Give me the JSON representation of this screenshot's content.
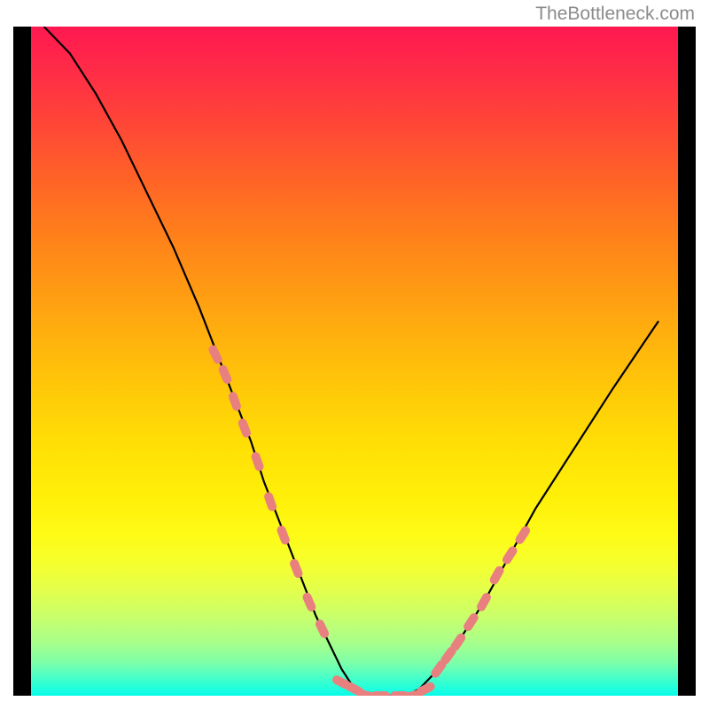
{
  "watermark": "TheBottleneck.com",
  "chart_data": {
    "type": "line",
    "title": "",
    "xlabel": "",
    "ylabel": "",
    "xlim": [
      0,
      100
    ],
    "ylim": [
      0,
      100
    ],
    "grid": false,
    "series": [
      {
        "name": "bottleneck-curve",
        "color": "#000000",
        "x": [
          2,
          6,
          10,
          14,
          18,
          22,
          26,
          28,
          30,
          32,
          34,
          36,
          38,
          40,
          42,
          44,
          46,
          48,
          50,
          52,
          54,
          56,
          58,
          60,
          62,
          66,
          70,
          74,
          78,
          84,
          90,
          97
        ],
        "y": [
          100,
          96,
          90,
          83,
          75,
          67,
          58,
          53,
          48,
          43,
          38,
          32,
          27,
          22,
          17,
          12,
          8,
          4,
          1,
          0,
          0,
          0,
          0,
          1,
          3,
          8,
          14,
          21,
          28,
          37,
          46,
          56
        ]
      }
    ],
    "markers": [
      {
        "name": "left-descent-markers",
        "color": "#e98080",
        "shape": "pill",
        "x": [
          28.5,
          30,
          31.5,
          33,
          35,
          37,
          39,
          41,
          43,
          45
        ],
        "y": [
          51,
          48,
          44,
          40,
          35,
          29,
          24,
          19,
          14,
          10
        ]
      },
      {
        "name": "valley-floor-markers",
        "color": "#e98080",
        "shape": "pill",
        "x": [
          48,
          50,
          52,
          54,
          57,
          59,
          61
        ],
        "y": [
          2,
          1,
          0,
          0,
          0,
          0,
          1
        ]
      },
      {
        "name": "right-ascent-markers",
        "color": "#e98080",
        "shape": "pill",
        "x": [
          63,
          64.5,
          66,
          68,
          70,
          72,
          74,
          76
        ],
        "y": [
          4,
          6,
          8,
          11,
          14,
          18,
          21,
          24
        ]
      }
    ],
    "gradient": {
      "axis": "y",
      "stops": [
        {
          "pos": 0.0,
          "color": "#06fbe8"
        },
        {
          "pos": 0.03,
          "color": "#4effc4"
        },
        {
          "pos": 0.08,
          "color": "#a8ff8a"
        },
        {
          "pos": 0.16,
          "color": "#e4ff4a"
        },
        {
          "pos": 0.24,
          "color": "#fefb16"
        },
        {
          "pos": 0.38,
          "color": "#ffde06"
        },
        {
          "pos": 0.54,
          "color": "#ffb00e"
        },
        {
          "pos": 0.7,
          "color": "#ff7c1c"
        },
        {
          "pos": 0.86,
          "color": "#ff4438"
        },
        {
          "pos": 1.0,
          "color": "#ff1850"
        }
      ]
    }
  }
}
